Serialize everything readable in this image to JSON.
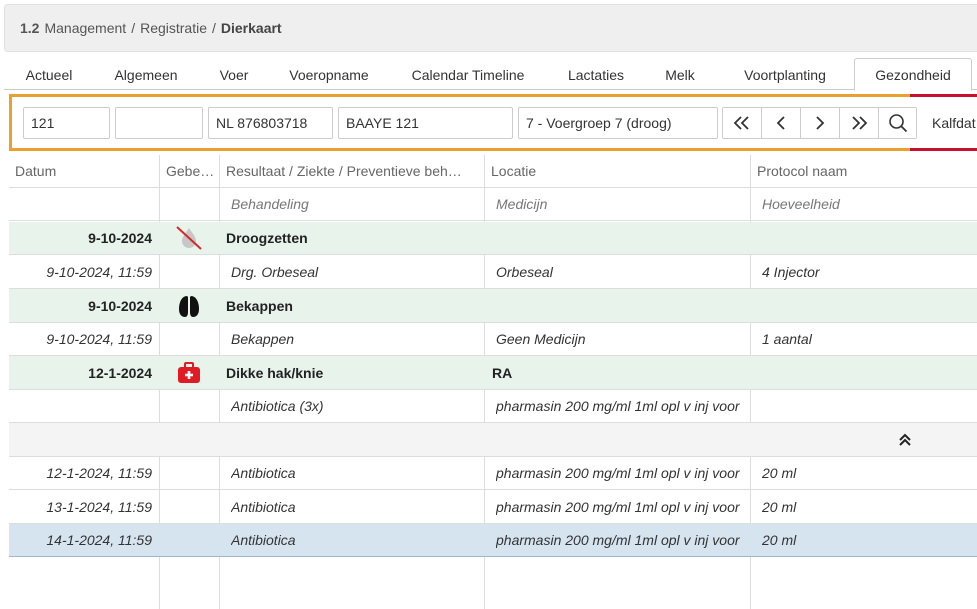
{
  "breadcrumb": {
    "number": "1.2",
    "items": [
      "Management",
      "Registratie"
    ],
    "current": "Dierkaart",
    "separator": "/"
  },
  "tabs": [
    "Actueel",
    "Algemeen",
    "Voer",
    "Voeropname",
    "Calendar Timeline",
    "Lactaties",
    "Melk",
    "Voortplanting",
    "Gezondheid"
  ],
  "active_tab": "Gezondheid",
  "toolbar": {
    "animal_number": "121",
    "empty_field": "",
    "life_number": "NL 876803718",
    "name": "BAAYE 121",
    "feed_group": "7 - Voergroep 7 (droog)",
    "calving_label": "Kalfdat"
  },
  "table": {
    "headers": [
      "Datum",
      "Gebe…",
      "Resultaat / Ziekte / Preventieve beh…",
      "Locatie",
      "Protocol naam"
    ],
    "subheaders": [
      "",
      "",
      "Behandeling",
      "Medicijn",
      "Hoeveelheid"
    ],
    "rows": [
      {
        "kind": "group",
        "date": "9-10-2024",
        "icon": "dry-off-icon",
        "result": "Droogzetten",
        "location": "",
        "protocol": ""
      },
      {
        "kind": "detail",
        "date": "9-10-2024, 11:59",
        "icon": "",
        "result": "Drg. Orbeseal",
        "location": "Orbeseal",
        "protocol": "4 Injector"
      },
      {
        "kind": "group",
        "date": "9-10-2024",
        "icon": "hoof-icon",
        "result": "Bekappen",
        "location": "",
        "protocol": ""
      },
      {
        "kind": "detail",
        "date": "9-10-2024, 11:59",
        "icon": "",
        "result": "Bekappen",
        "location": "Geen Medicijn",
        "protocol": "1 aantal"
      },
      {
        "kind": "group",
        "date": "12-1-2024",
        "icon": "first-aid-kit-icon",
        "result": "Dikke hak/knie",
        "location": "RA",
        "protocol": ""
      },
      {
        "kind": "detail",
        "date": "",
        "icon": "",
        "result": "Antibiotica (3x)",
        "location": "pharmasin 200 mg/ml 1ml opl v inj voor",
        "protocol": ""
      },
      {
        "kind": "collapse",
        "date": "",
        "icon": "",
        "result": "",
        "location": "",
        "protocol": ""
      },
      {
        "kind": "detail",
        "date": "12-1-2024, 11:59",
        "icon": "",
        "result": "Antibiotica",
        "location": "pharmasin 200 mg/ml 1ml opl v inj voor",
        "protocol": "20 ml"
      },
      {
        "kind": "detail",
        "date": "13-1-2024, 11:59",
        "icon": "",
        "result": "Antibiotica",
        "location": "pharmasin 200 mg/ml 1ml opl v inj voor",
        "protocol": "20 ml"
      },
      {
        "kind": "selected",
        "date": "14-1-2024, 11:59",
        "icon": "",
        "result": "Antibiotica",
        "location": "pharmasin 200 mg/ml 1ml opl v inj voor",
        "protocol": "20 ml"
      }
    ]
  },
  "colors": {
    "toolbar_border": "#e8a030",
    "accent_red": "#c8102e",
    "group_row": "#e8f4eb",
    "selected_row": "#d6e4f0"
  }
}
